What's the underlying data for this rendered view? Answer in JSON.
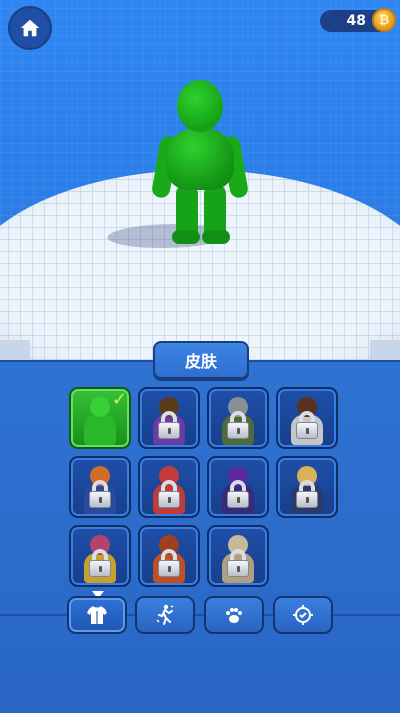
{
  "header": {
    "coins": "48",
    "coin_symbol": "₿",
    "icons": {
      "home": "home-icon",
      "coin": "coin-icon"
    }
  },
  "panel": {
    "title": "皮肤"
  },
  "skins": [
    {
      "name": "green",
      "state": "selected",
      "head": "#36d136",
      "body": "#2ab82a"
    },
    {
      "name": "witch",
      "state": "locked",
      "head": "#5b3a1c",
      "body": "#6a3aa8"
    },
    {
      "name": "knight",
      "state": "locked",
      "head": "#8a8f96",
      "body": "#4f6b3a"
    },
    {
      "name": "samurai",
      "state": "locked",
      "head": "#5a3320",
      "body": "#c3c5c9"
    },
    {
      "name": "farmer",
      "state": "locked",
      "head": "#d06b2a",
      "body": "#2a4aa0"
    },
    {
      "name": "santa",
      "state": "locked",
      "head": "#c23a3a",
      "body": "#c23a3a"
    },
    {
      "name": "mage",
      "state": "locked",
      "head": "#5a2a9a",
      "body": "#3a2a7a"
    },
    {
      "name": "straw-hat",
      "state": "locked",
      "head": "#d8b35a",
      "body": "#2a3a6a"
    },
    {
      "name": "clown",
      "state": "locked",
      "head": "#b0446a",
      "body": "#c8a030"
    },
    {
      "name": "lion",
      "state": "locked",
      "head": "#a04020",
      "body": "#c05020"
    },
    {
      "name": "mummy",
      "state": "locked",
      "head": "#c8b89a",
      "body": "#b0a080"
    }
  ],
  "tabs": [
    {
      "id": "skins",
      "icon": "shirt-icon",
      "active": true
    },
    {
      "id": "emotes",
      "icon": "dance-icon",
      "active": false
    },
    {
      "id": "pets",
      "icon": "paw-icon",
      "active": false
    },
    {
      "id": "effects",
      "icon": "target-icon",
      "active": false
    }
  ]
}
